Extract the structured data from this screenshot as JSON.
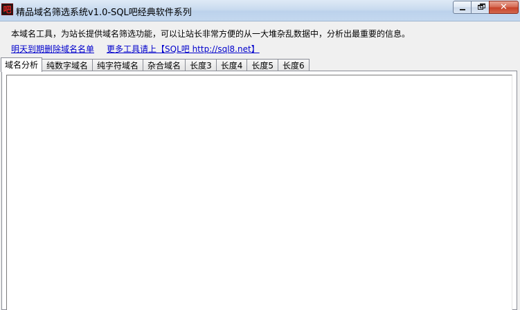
{
  "window": {
    "icon_text": "吧",
    "title": "精品域名筛选系统v1.0-SQL吧经典软件系列",
    "buttons": {
      "minimize": "minimize",
      "maximize": "maximize",
      "close": "✕"
    }
  },
  "description": "本域名工具，为站长提供域名筛选功能，可以让站长非常方便的从一大堆杂乱数据中，分析出最重要的信息。",
  "links": [
    {
      "label": "明天到期删除域名名单"
    },
    {
      "label": "更多工具请上【SQL吧 http://sql8.net】"
    }
  ],
  "tabs": [
    {
      "label": "域名分析",
      "active": true
    },
    {
      "label": "纯数字域名"
    },
    {
      "label": "纯字符域名"
    },
    {
      "label": "杂合域名"
    },
    {
      "label": "长度3"
    },
    {
      "label": "长度4"
    },
    {
      "label": "长度5"
    },
    {
      "label": "长度6"
    }
  ],
  "content": {
    "text": ""
  },
  "colors": {
    "link": "#0000cc",
    "close_button": "#c7432a",
    "titlebar": "#c9dbef"
  },
  "icons": {
    "app": "app-logo-icon",
    "minimize": "minimize-icon",
    "maximize": "maximize-icon",
    "close": "close-icon"
  }
}
